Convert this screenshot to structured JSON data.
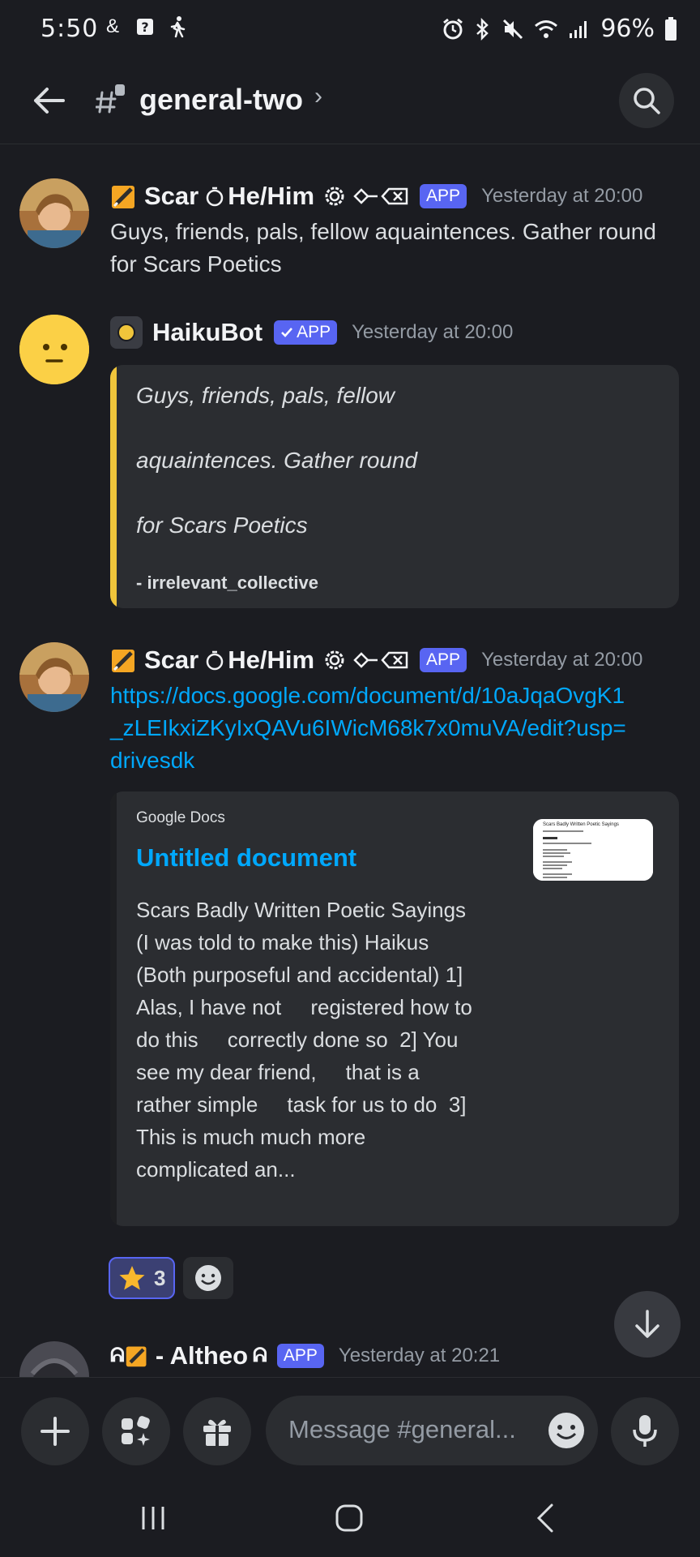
{
  "status_bar": {
    "time": "5:50",
    "battery": "96%"
  },
  "header": {
    "channel_name": "general-two"
  },
  "messages": [
    {
      "username": "Scar",
      "pronoun": "He/Him",
      "badge": "APP",
      "timestamp": "Yesterday at 20:00",
      "text": "Guys, friends, pals, fellow aquaintences. Gather round for Scars Poetics"
    },
    {
      "username": "HaikuBot",
      "badge": "APP",
      "timestamp": "Yesterday at 20:00",
      "embed": {
        "line1": "Guys, friends, pals, fellow",
        "line2": "aquaintences. Gather round",
        "line3": "for Scars Poetics",
        "credit": "- irrelevant_collective",
        "accent_color": "#f0c53b"
      }
    },
    {
      "username": "Scar",
      "pronoun": "He/Him",
      "badge": "APP",
      "timestamp": "Yesterday at 20:00",
      "link": "https://docs.google.com/document/d/10aJqaOvgK1_zLEIkxiZKyIxQAVu6IWicM68k7x0muVA/edit?usp=drivesdk",
      "embed": {
        "provider": "Google Docs",
        "title": "Untitled document",
        "description": "Scars Badly Written Poetic Sayings (I was told to make this) Haikus  (Both purposeful and accidental) 1] Alas, I have not     registered how to do this     correctly done so  2] You see my dear friend,     that is a rather simple     task for us to do  3] This is much much more complicated an...",
        "thumbnail_title": "Scars Badly Written Poetic Sayings",
        "accent_color": "#1e1f22"
      },
      "reactions": [
        {
          "emoji": "star",
          "count": "3"
        }
      ]
    },
    {
      "username": "- Altheo",
      "badge": "APP",
      "timestamp": "Yesterday at 20:21"
    }
  ],
  "composer": {
    "placeholder": "Message #general..."
  },
  "colors": {
    "background": "#1b1c21",
    "embed_bg": "#2b2d31",
    "link": "#00a8fc",
    "badge": "#5865f2"
  },
  "icons": [
    "back-arrow-icon",
    "channel-thread-icon",
    "search-icon",
    "plus-icon",
    "apps-icon",
    "gift-icon",
    "emoji-icon",
    "mic-icon",
    "scroll-down-icon"
  ]
}
